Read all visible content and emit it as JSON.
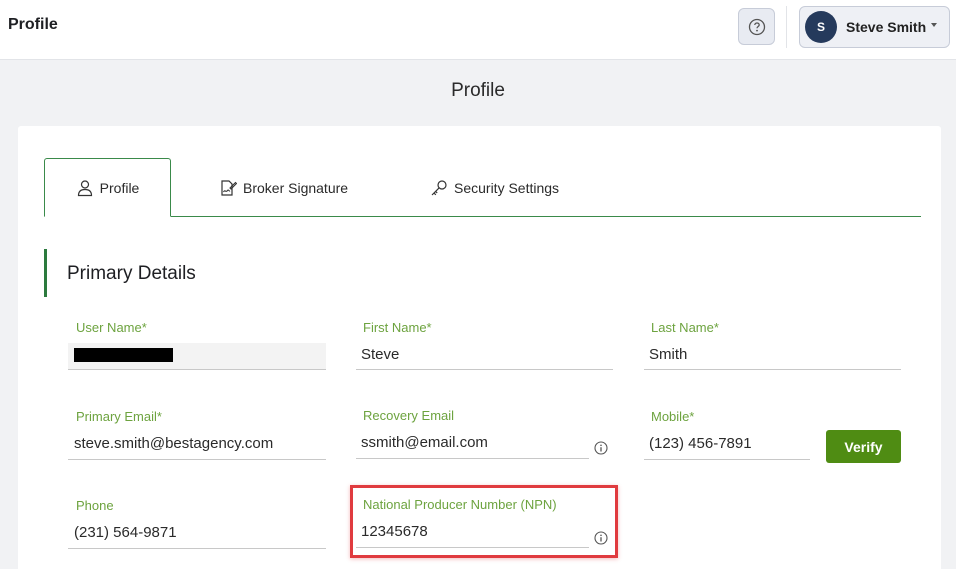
{
  "header": {
    "title": "Profile",
    "help_icon": "question-circle-icon",
    "user": {
      "initial": "S",
      "name": "Steve Smith"
    }
  },
  "page": {
    "title": "Profile"
  },
  "tabs": [
    {
      "label": "Profile",
      "icon": "user-icon",
      "active": true
    },
    {
      "label": "Broker Signature",
      "icon": "signature-icon",
      "active": false
    },
    {
      "label": "Security Settings",
      "icon": "key-icon",
      "active": false
    }
  ],
  "section": {
    "title": "Primary Details"
  },
  "fields": {
    "username": {
      "label": "User Name*",
      "redacted": true
    },
    "first_name": {
      "label": "First Name*",
      "value": "Steve"
    },
    "last_name": {
      "label": "Last Name*",
      "value": "Smith"
    },
    "primary_email": {
      "label": "Primary Email*",
      "value": "steve.smith@bestagency.com"
    },
    "recovery_email": {
      "label": "Recovery Email",
      "value": "ssmith@email.com"
    },
    "mobile": {
      "label": "Mobile*",
      "value": "(123) 456-7891"
    },
    "phone": {
      "label": "Phone",
      "value": "(231) 564-9871"
    },
    "npn": {
      "label": "National Producer Number (NPN)",
      "value": "12345678"
    }
  },
  "buttons": {
    "verify": "Verify"
  },
  "colors": {
    "accent_green": "#4f8c13",
    "label_green": "#6da33f",
    "highlight_red": "#e03b3f",
    "avatar_navy": "#253a5c"
  }
}
